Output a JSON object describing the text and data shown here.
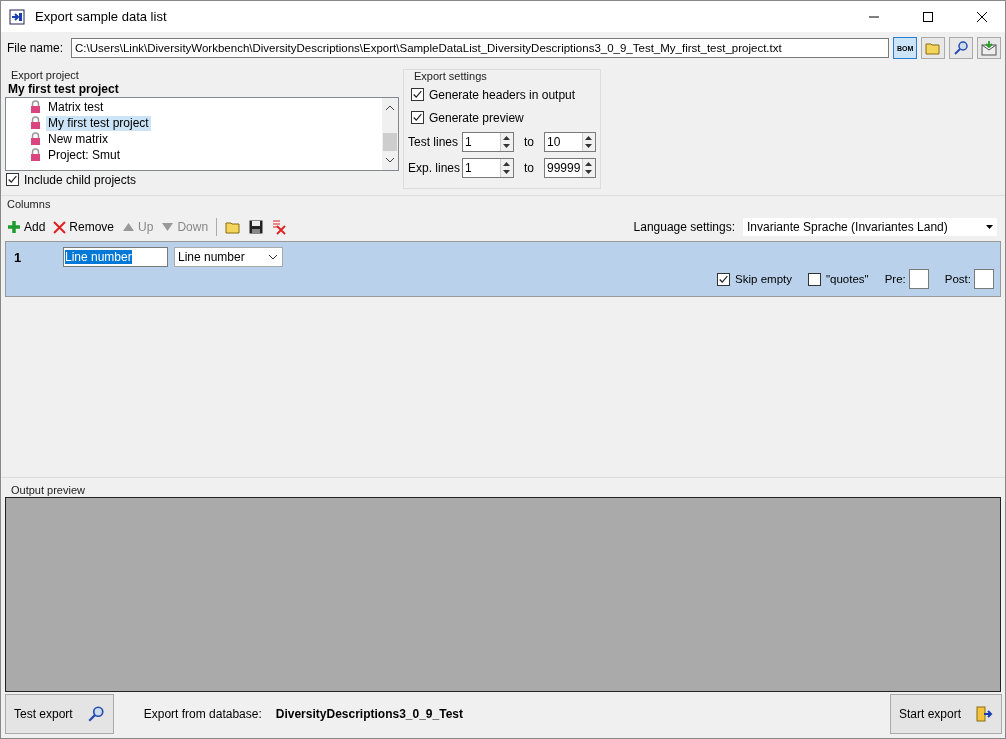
{
  "window": {
    "title": "Export sample data list"
  },
  "file": {
    "label": "File name:",
    "value": "C:\\Users\\Link\\DiversityWorkbench\\DiversityDescriptions\\Export\\SampleDataList_DiversityDescriptions3_0_9_Test_My_first_test_project.txt",
    "bom_label": "BOM"
  },
  "export_project": {
    "title": "Export project",
    "current": "My first test project",
    "items": [
      {
        "label": "Matrix test",
        "selected": false
      },
      {
        "label": "My first test project",
        "selected": true
      },
      {
        "label": "New matrix",
        "selected": false
      },
      {
        "label": "Project: Smut",
        "selected": false
      }
    ],
    "include_children": {
      "label": "Include child projects",
      "checked": true
    }
  },
  "export_settings": {
    "title": "Export settings",
    "options": [
      {
        "label": "Generate headers in output",
        "checked": true
      },
      {
        "label": "Generate preview",
        "checked": true
      }
    ],
    "ranges": [
      {
        "label": "Test lines",
        "from": "1",
        "to_label": "to",
        "to": "10"
      },
      {
        "label": "Exp. lines",
        "from": "1",
        "to_label": "to",
        "to": "99999"
      }
    ]
  },
  "columns": {
    "title": "Columns",
    "toolbar": [
      {
        "kind": "add",
        "label": "Add",
        "disabled": false
      },
      {
        "kind": "remove",
        "label": "Remove",
        "disabled": false
      },
      {
        "kind": "up",
        "label": "Up",
        "disabled": true
      },
      {
        "kind": "down",
        "label": "Down",
        "disabled": true
      }
    ],
    "language_label": "Language settings:",
    "language": "Invariante Sprache (Invariantes Land)",
    "rows": [
      {
        "number": "1",
        "name": "Line number",
        "source": "Line number",
        "skip_empty": {
          "label": "Skip empty",
          "checked": true
        },
        "quotes": {
          "label": "\"quotes\"",
          "checked": false
        },
        "pre_label": "Pre:",
        "post_label": "Post:"
      }
    ]
  },
  "output_preview": {
    "title": "Output preview"
  },
  "footer": {
    "test_button": "Test export",
    "db_label": "Export from database:",
    "db_name": "DiversityDescriptions3_0_9_Test",
    "start_button": "Start export"
  }
}
